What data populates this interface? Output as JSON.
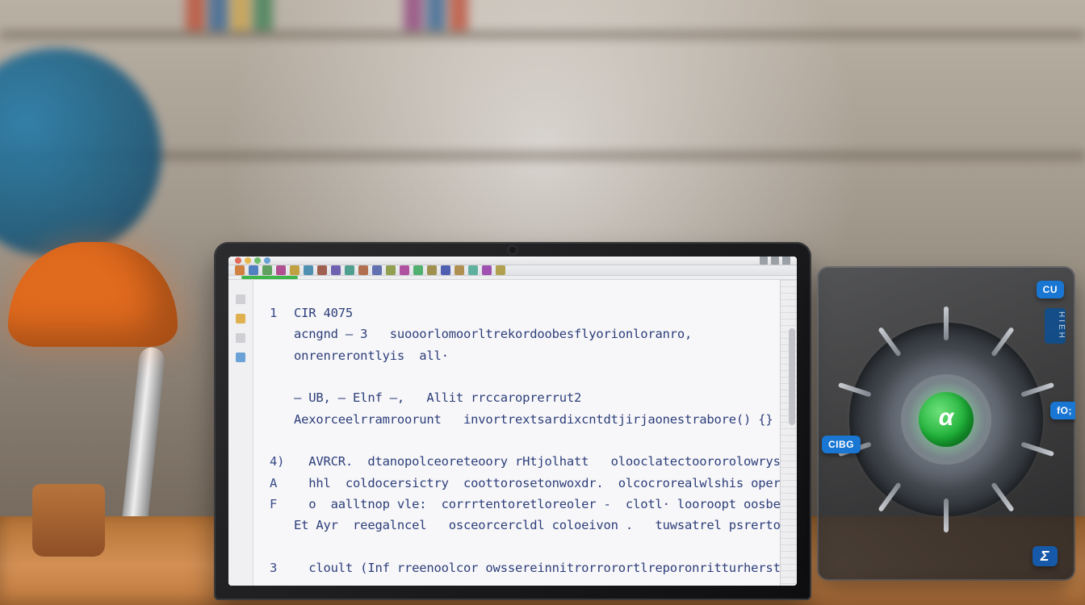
{
  "titlebar": {
    "dot_colors": [
      "#e06c5c",
      "#e8b94e",
      "#6bbf6b",
      "#6aa2d8"
    ],
    "control_count": 3
  },
  "toolbar": {
    "icon_colors": [
      "#d08040",
      "#5080c0",
      "#60a060",
      "#b05090",
      "#c0a040",
      "#5090b0",
      "#a06050",
      "#7060b0",
      "#50a090",
      "#b07050",
      "#6070b0",
      "#90a050",
      "#b050a0",
      "#50b070",
      "#a09050",
      "#5060b0",
      "#b09050",
      "#60b0a0",
      "#a050b0",
      "#b0a050"
    ]
  },
  "code": {
    "lines": [
      {
        "n": "1",
        "indent": 0,
        "text": "CIR 4075"
      },
      {
        "n": "",
        "indent": 0,
        "text": "acngnd — 3   suooorlomoorltrekordoobesflyorionloranro,"
      },
      {
        "n": "",
        "indent": 0,
        "text": "onrenrerontlyis  all·"
      },
      {
        "n": "",
        "indent": 0,
        "text": ""
      },
      {
        "n": "",
        "indent": 0,
        "text": "– UB, – Elnf –,   Allit rrccaroprerrut2"
      },
      {
        "n": "",
        "indent": 0,
        "text": "Aexorceelrramroorunt   invortrextsardixcntdtjirjaonestrabore() {}"
      },
      {
        "n": "",
        "indent": 0,
        "text": ""
      },
      {
        "n": "4)",
        "indent": 1,
        "text": "AVRCR.  dtanopolceoreteoory rHtjolhatt   olooclatectoororolowrys;"
      },
      {
        "n": "A",
        "indent": 1,
        "text": "hhl  coldocersictry  coottorosetonwoxdr.  olcocrorealwlshis operthren()"
      },
      {
        "n": "F",
        "indent": 1,
        "text": "o  aalltnop vle:  corrrtentoretloreoler -  clotl· looroopt oosbenle"
      },
      {
        "n": "",
        "indent": 0,
        "text": "Et Ayr  reegalncel   osceorcercldl coloeivon .   tuwsatrel psrertornolfla"
      },
      {
        "n": "",
        "indent": 0,
        "text": ""
      },
      {
        "n": "3",
        "indent": 1,
        "text": "cloult (Inf rreenoolcor owssereinnitrorrorortlreporonritturherst() ,"
      }
    ]
  },
  "device": {
    "chips": {
      "top": "CU",
      "right": "fO;",
      "left": "CIBG",
      "bottom": "Σ"
    },
    "strip": "HIEH",
    "core_glyph": "α"
  }
}
